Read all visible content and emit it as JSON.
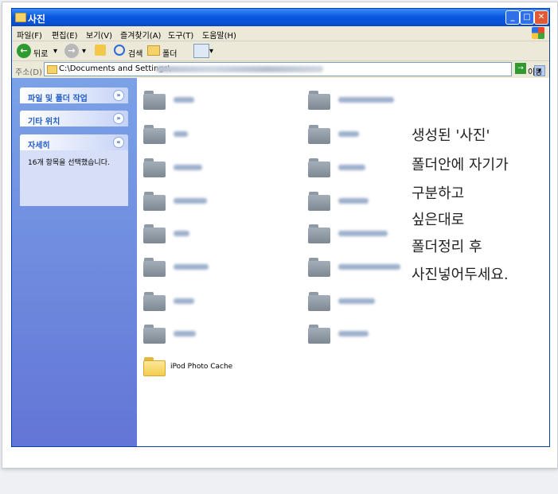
{
  "window": {
    "title": "사진"
  },
  "menu": [
    "파일(F)",
    "편집(E)",
    "보기(V)",
    "즐겨찾기(A)",
    "도구(T)",
    "도움말(H)"
  ],
  "toolbar": {
    "back": "뒤로",
    "search": "검색",
    "folders": "폴더"
  },
  "address": {
    "label": "주소(D)",
    "value": "C:\\Documents and Settings\\",
    "go": "이동"
  },
  "sidebar": {
    "file_tasks": "파일 및 폴더 작업",
    "other_places": "기타 위치",
    "details": "자세히",
    "details_text": "16개 항목을 선택했습니다."
  },
  "files": {
    "ipod": "iPod Photo Cache"
  },
  "note": {
    "line1": "생성된 '사진'",
    "line2": "폴더안에 자기가",
    "line3": "구분하고",
    "line4": "싶은대로",
    "line5": "폴더정리 후",
    "line6": "사진넣어두세요."
  }
}
